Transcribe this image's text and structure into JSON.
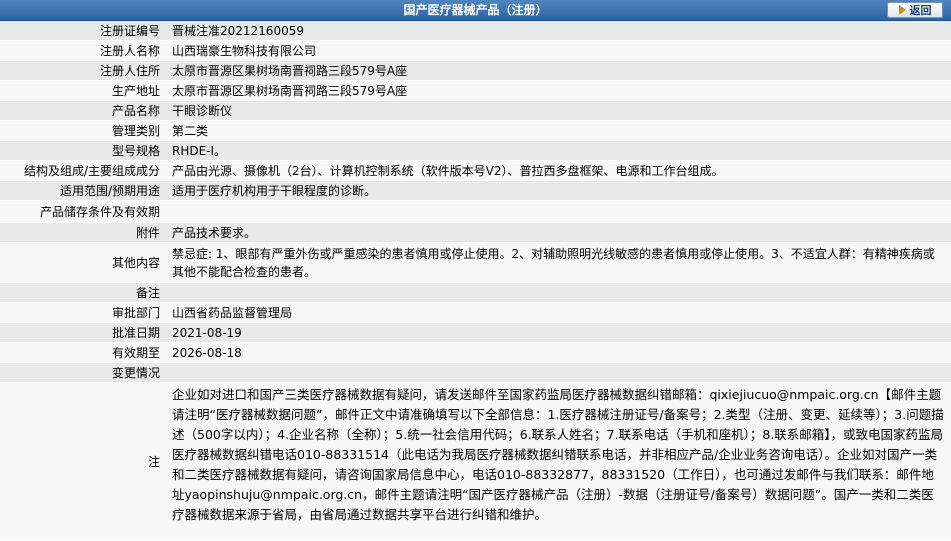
{
  "header": {
    "title": "国产医疗器械产品（注册）",
    "back_label": "返回"
  },
  "rows": [
    {
      "label": "注册证编号",
      "value": "晋械注准20212160059"
    },
    {
      "label": "注册人名称",
      "value": "山西瑞豪生物科技有限公司"
    },
    {
      "label": "注册人住所",
      "value": "太原市晋源区果树场南晋祠路三段579号A座"
    },
    {
      "label": "生产地址",
      "value": "太原市晋源区果树场南晋祠路三段579号A座"
    },
    {
      "label": "产品名称",
      "value": "干眼诊断仪"
    },
    {
      "label": "管理类别",
      "value": "第二类"
    },
    {
      "label": "型号规格",
      "value": "RHDE-Ⅰ。"
    },
    {
      "label": "结构及组成/主要组成成分",
      "value": "产品由光源、摄像机（2台）、计算机控制系统（软件版本号V2）、普拉西多盘框架、电源和工作台组成。"
    },
    {
      "label": "适用范围/预期用途",
      "value": "适用于医疗机构用于干眼程度的诊断。"
    },
    {
      "label": "产品储存条件及有效期",
      "value": ""
    },
    {
      "label": "附件",
      "value": "产品技术要求。"
    },
    {
      "label": "其他内容",
      "value": "禁忌症: 1、眼部有严重外伤或严重感染的患者慎用或停止使用。2、对辅助照明光线敏感的患者慎用或停止使用。3、不适宜人群：有精神疾病或其他不能配合检查的患者。"
    },
    {
      "label": "备注",
      "value": ""
    },
    {
      "label": "审批部门",
      "value": "山西省药品监督管理局"
    },
    {
      "label": "批准日期",
      "value": "2021-08-19"
    },
    {
      "label": "有效期至",
      "value": "2026-08-18"
    },
    {
      "label": "变更情况",
      "value": ""
    }
  ],
  "note": {
    "label": "注",
    "text": "企业如对进口和国产三类医疗器械数据有疑问，请发送邮件至国家药监局医疗器械数据纠错邮箱：qixiejiucuo@nmpaic.org.cn【邮件主题请注明“医疗器械数据问题”，邮件正文中请准确填写以下全部信息：1.医疗器械注册证号/备案号；2.类型（注册、变更、延续等）；3.问题描述（500字以内）；4.企业名称（全称）；5.统一社会信用代码；6.联系人姓名；7.联系电话（手机和座机）；8.联系邮箱】，或致电国家药监局医疗器械数据纠错电话010-88331514（此电话为我局医疗器械数据纠错联系电话，并非相应产品/企业业务咨询电话）。企业如对国产一类和二类医疗器械数据有疑问，请咨询国家局信息中心，电话010-88332877，88331520（工作日），也可通过发邮件与我们联系：邮件地址yaopinshuju@nmpaic.org.cn，邮件主题请注明“国产医疗器械产品（注册）-数据（注册证号/备案号）数据问题”。国产一类和二类医疗器械数据来源于省局，由省局通过数据共享平台进行纠错和维护。"
  },
  "colors": {
    "header_bg": "#3a72b0",
    "row_odd": "#e8e8e8",
    "row_even": "#f7f7f7"
  }
}
